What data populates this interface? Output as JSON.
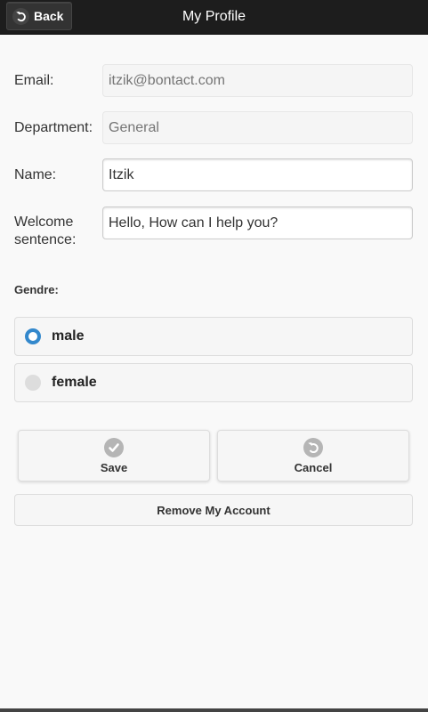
{
  "header": {
    "back_label": "Back",
    "title": "My Profile",
    "back_icon": "undo-arrow-icon",
    "bar_color": "#1d1d1d"
  },
  "form": {
    "email": {
      "label": "Email:",
      "placeholder": "itzik@bontact.com",
      "value": ""
    },
    "department": {
      "label": "Department:",
      "placeholder": "General",
      "value": ""
    },
    "name": {
      "label": "Name:",
      "value": "Itzik"
    },
    "welcome": {
      "label_line1": "Welcome",
      "label_line2": "sentence:",
      "value": "Hello, How can I help you?"
    }
  },
  "gender": {
    "label": "Gendre:",
    "options": [
      {
        "label": "male",
        "checked": true
      },
      {
        "label": "female",
        "checked": false
      }
    ],
    "accent_color": "#3388cc"
  },
  "actions": {
    "save_label": "Save",
    "save_icon": "check-icon",
    "cancel_label": "Cancel",
    "cancel_icon": "undo-arrow-icon",
    "remove_label": "Remove My Account"
  }
}
